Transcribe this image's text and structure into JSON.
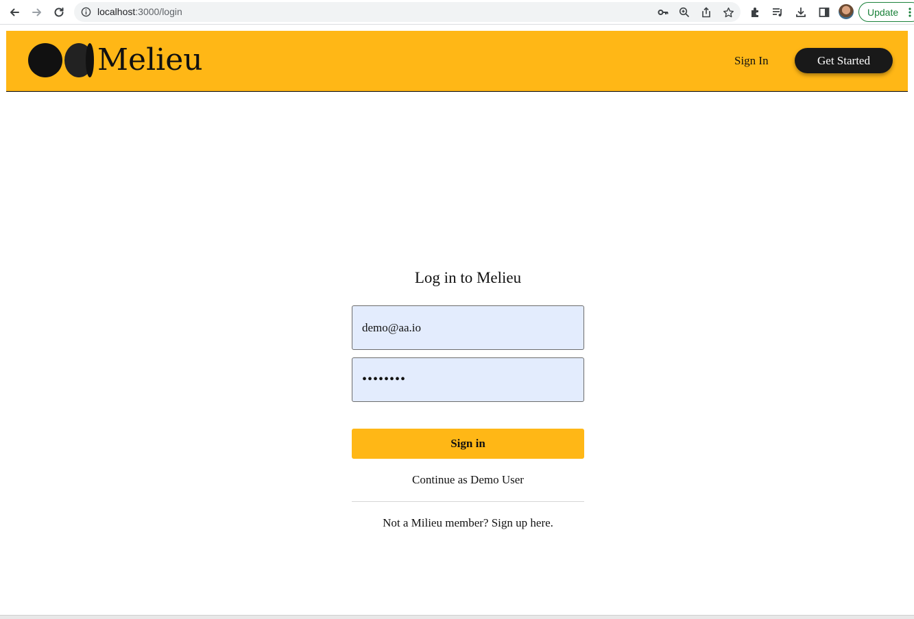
{
  "browser": {
    "url_host": "localhost",
    "url_path": ":3000/login",
    "update_label": "Update",
    "icons": [
      "back-icon",
      "forward-icon",
      "reload-icon",
      "info-icon",
      "key-icon",
      "zoom-icon",
      "share-icon",
      "star-icon",
      "extensions-icon",
      "media-icon",
      "download-icon",
      "sidebar-icon",
      "profile-avatar",
      "menu-icon"
    ]
  },
  "header": {
    "logo_text": "Melieu",
    "nav_signin": "Sign In",
    "nav_get_started": "Get Started",
    "background_color": "#ffb716",
    "button_color": "#191919"
  },
  "login": {
    "title": "Log in to Melieu",
    "email_value": "demo@aa.io",
    "password_value": "••••••••",
    "signin_label": "Sign in",
    "demo_label": "Continue as Demo User",
    "signup_prefix": "Not a Milieu member?",
    "signup_link": "Sign up here.",
    "field_color": "#e3ecfd",
    "button_color": "#ffb716"
  }
}
